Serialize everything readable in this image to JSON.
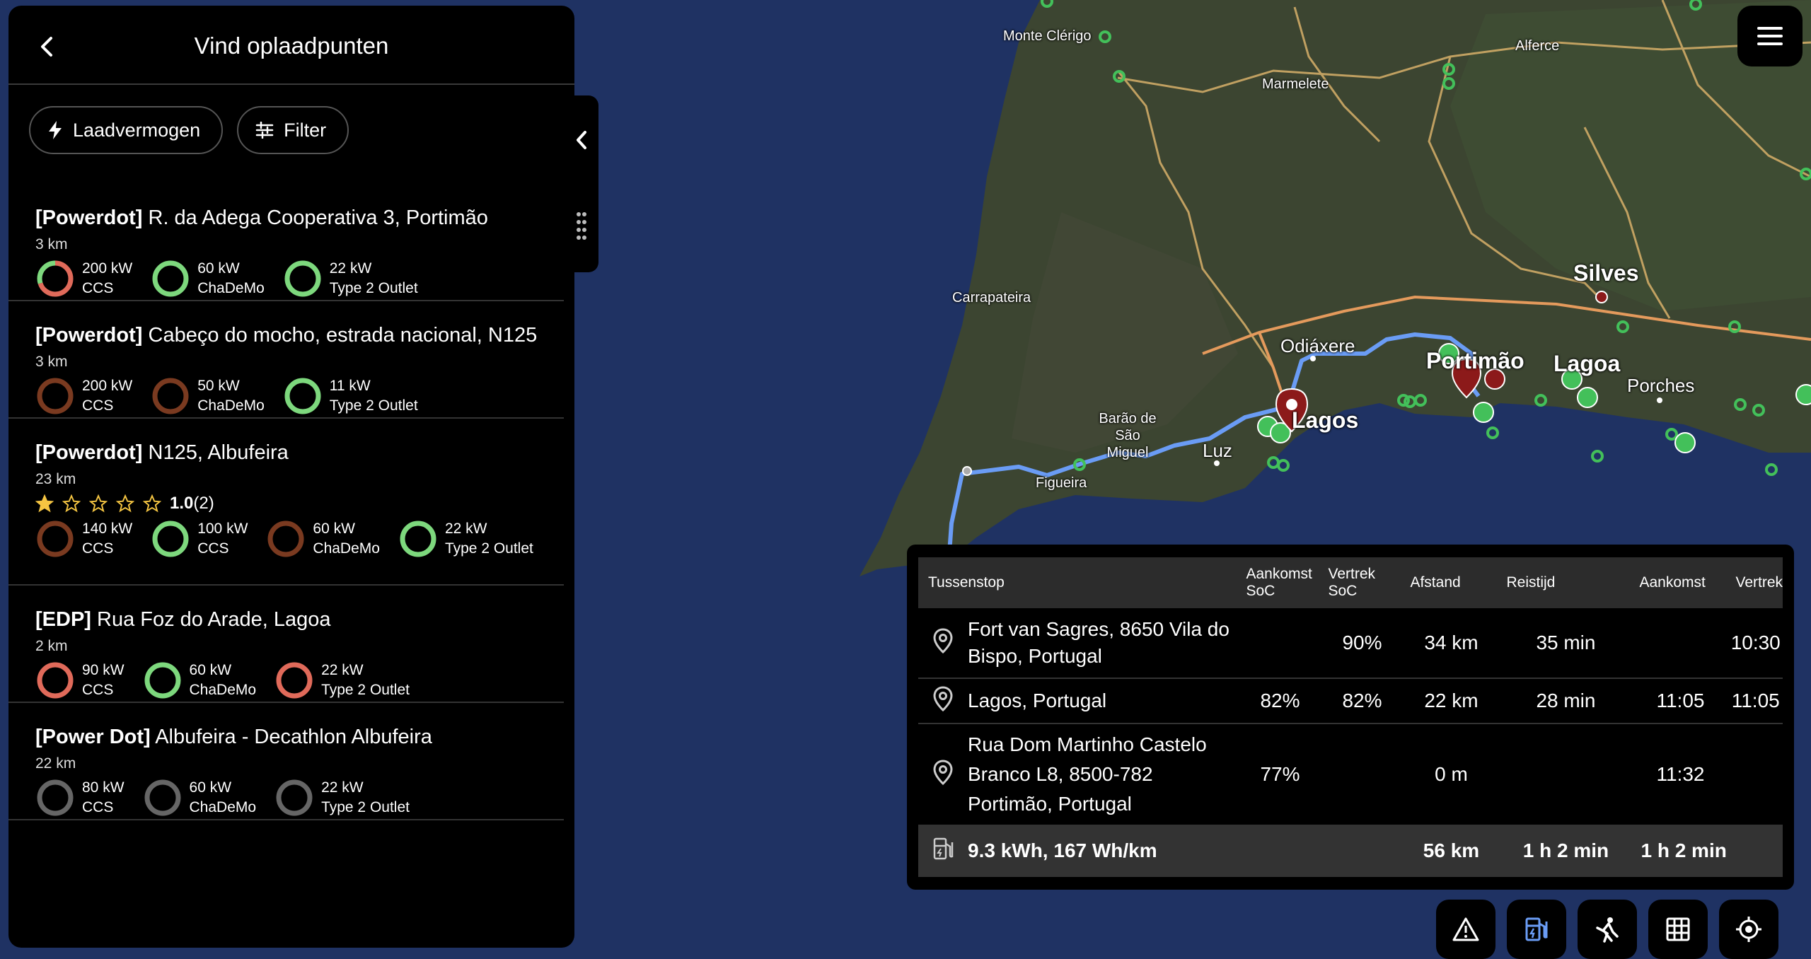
{
  "panel": {
    "title": "Vind oplaadpunten",
    "chips": [
      {
        "label": "Laadvermogen",
        "icon": "lightning-icon"
      },
      {
        "label": "Filter",
        "icon": "sliders-icon"
      }
    ],
    "stations": [
      {
        "network": "[Powerdot]",
        "address": "R. da Adega Cooperativa 3, Portimão",
        "distance": "3 km",
        "rating": null,
        "connectors": [
          {
            "power": "200 kW",
            "type": "CCS",
            "status_color": "#e06a5a",
            "availability": 0.7
          },
          {
            "power": "60 kW",
            "type": "ChaDeMo",
            "status_color": "#7dd87d",
            "availability": 1
          },
          {
            "power": "22 kW",
            "type": "Type 2 Outlet",
            "status_color": "#7dd87d",
            "availability": 1
          }
        ]
      },
      {
        "network": "[Powerdot]",
        "address": "Cabeço do mocho, estrada nacional, N125",
        "distance": "3 km",
        "rating": null,
        "connectors": [
          {
            "power": "200 kW",
            "type": "CCS",
            "status_color": "#7a3a20",
            "availability": 1
          },
          {
            "power": "50 kW",
            "type": "ChaDeMo",
            "status_color": "#7a3a20",
            "availability": 1
          },
          {
            "power": "11 kW",
            "type": "Type 2 Outlet",
            "status_color": "#7dd87d",
            "availability": 1
          }
        ]
      },
      {
        "network": "[Powerdot]",
        "address": "N125, Albufeira",
        "distance": "23 km",
        "rating": {
          "value": "1.0",
          "count": "(2)",
          "stars": 1
        },
        "connectors": [
          {
            "power": "140 kW",
            "type": "CCS",
            "status_color": "#7a3a20",
            "availability": 1
          },
          {
            "power": "100 kW",
            "type": "CCS",
            "status_color": "#7dd87d",
            "availability": 1
          },
          {
            "power": "60 kW",
            "type": "ChaDeMo",
            "status_color": "#7a3a20",
            "availability": 1
          },
          {
            "power": "22 kW",
            "type": "Type 2 Outlet",
            "status_color": "#7dd87d",
            "availability": 1
          }
        ]
      },
      {
        "network": "[EDP]",
        "address": "Rua Foz do Arade, Lagoa",
        "distance": "2 km",
        "rating": null,
        "connectors": [
          {
            "power": "90 kW",
            "type": "CCS",
            "status_color": "#e06a5a",
            "availability": 1
          },
          {
            "power": "60 kW",
            "type": "ChaDeMo",
            "status_color": "#7dd87d",
            "availability": 1
          },
          {
            "power": "22 kW",
            "type": "Type 2 Outlet",
            "status_color": "#e06a5a",
            "availability": 1
          }
        ]
      },
      {
        "network": "[Power Dot]",
        "address": "Albufeira - Decathlon Albufeira",
        "distance": "22 km",
        "rating": null,
        "connectors": [
          {
            "power": "80 kW",
            "type": "CCS",
            "status_color": "#666666",
            "availability": 1
          },
          {
            "power": "60 kW",
            "type": "ChaDeMo",
            "status_color": "#666666",
            "availability": 1
          },
          {
            "power": "22 kW",
            "type": "Type 2 Outlet",
            "status_color": "#666666",
            "availability": 1
          }
        ]
      }
    ]
  },
  "map_labels": [
    "Monte Clérigo",
    "Marmelete",
    "Alferce",
    "Carrapateira",
    "Silves",
    "Odiáxere",
    "Portimão",
    "Lagoa",
    "Porches",
    "Barão de São Miguel",
    "Luz",
    "Lagos",
    "Figueira"
  ],
  "route": {
    "headers": [
      "Tussenstop",
      "Aankomst SoC",
      "Vertrek SoC",
      "Afstand",
      "Reistijd",
      "Aankomst",
      "Vertrek"
    ],
    "rows": [
      {
        "stop": "Fort van Sagres, 8650 Vila do Bispo, Portugal",
        "arrival_soc": "",
        "departure_soc": "90%",
        "distance": "34 km",
        "travel_time": "35 min",
        "arrival": "",
        "departure": "10:30"
      },
      {
        "stop": "Lagos, Portugal",
        "arrival_soc": "82%",
        "departure_soc": "82%",
        "distance": "22 km",
        "travel_time": "28 min",
        "arrival": "11:05",
        "departure": "11:05"
      },
      {
        "stop": "Rua Dom Martinho Castelo Branco L8, 8500-782 Portimão, Portugal",
        "arrival_soc": "77%",
        "departure_soc": "",
        "distance": "0 m",
        "travel_time": "",
        "arrival": "11:32",
        "departure": ""
      }
    ],
    "total": {
      "energy": "9.3 kWh, 167 Wh/km",
      "distance": "56 km",
      "travel_time": "1 h 2 min",
      "arrival": "1 h 2 min"
    }
  },
  "toolbar": [
    "warning-icon",
    "charger-icon",
    "roadworker-icon",
    "grid-icon",
    "locate-icon"
  ],
  "colors": {
    "accent_green": "#7dd87d",
    "busy_red": "#e06a5a",
    "route_blue": "#6a9cf5",
    "ocean": "#1f3263"
  }
}
